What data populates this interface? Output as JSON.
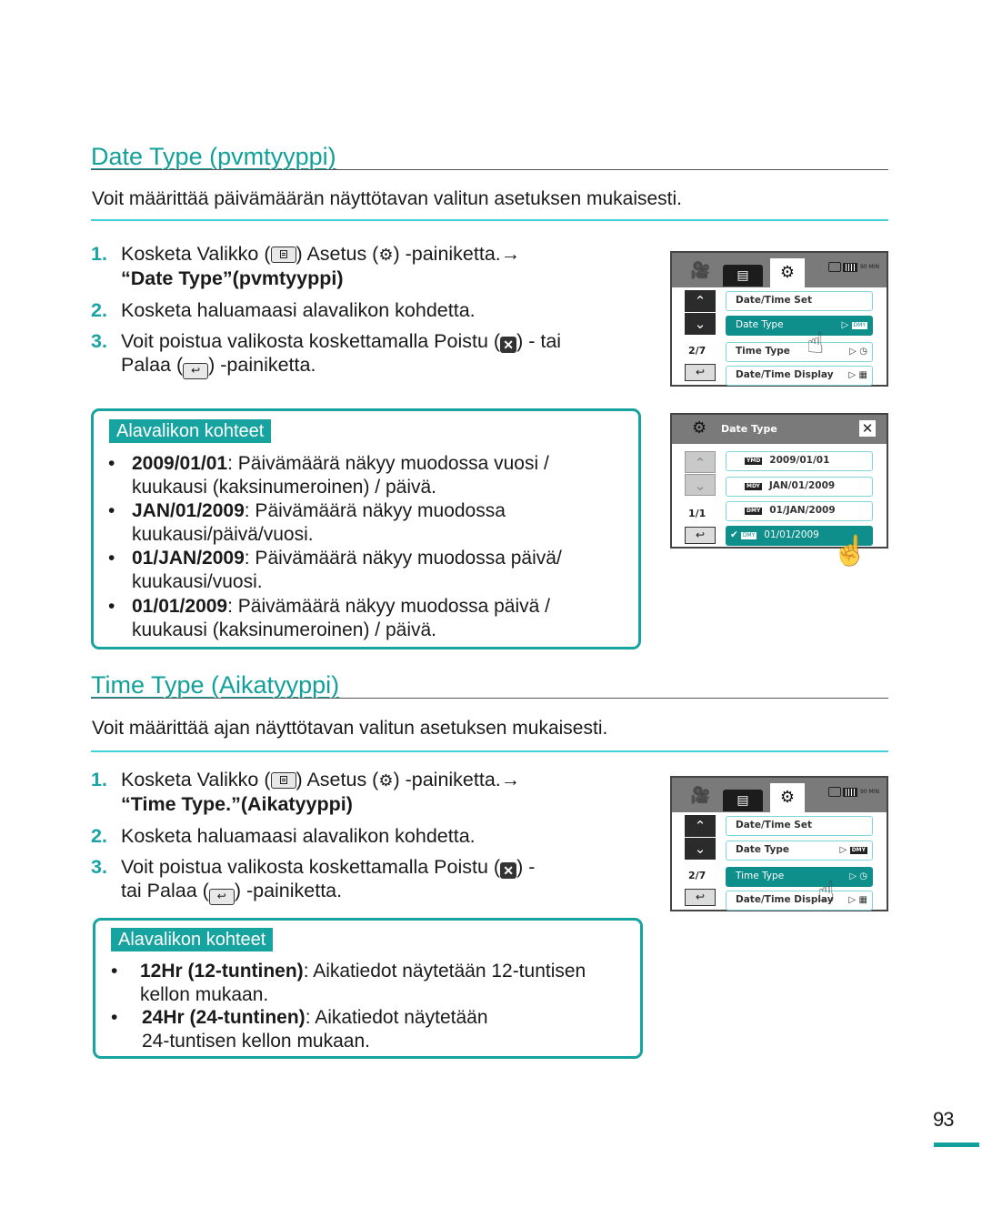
{
  "date_section": {
    "title": "Date Type (pvmtyyppi)",
    "intro": "Voit määrittää päivämäärän näyttötavan valitun asetuksen mukaisesti.",
    "steps": [
      {
        "num": "1.",
        "pre": "Kosketa Valikko (",
        "mid": ") Asetus (",
        "post": ") -painiketta.→",
        "bold": "“Date Type”(pvmtyyppi)"
      },
      {
        "num": "2.",
        "text": "Kosketa haluamaasi alavalikon kohdetta."
      },
      {
        "num": "3.",
        "pre": "Voit poistua valikosta koskettamalla Poistu (",
        "mid": ") - tai",
        "line2_pre": "Palaa (",
        "line2_post": ") -painiketta."
      }
    ],
    "submenu_label": "Alavalikon kohteet",
    "bullets": [
      {
        "bold": "2009/01/01",
        "line1": ": Päivämäärä näkyy muodossa vuosi /",
        "line2": "kuukausi (kaksinumeroinen) / päivä."
      },
      {
        "bold": "JAN/01/2009",
        "line1": ": Päivämäärä näkyy muodossa",
        "line2": "kuukausi/päivä/vuosi."
      },
      {
        "bold": "01/JAN/2009",
        "line1": ": Päivämäärä näkyy muodossa päivä/",
        "line2": "kuukausi/vuosi."
      },
      {
        "bold": "01/01/2009",
        "line1": ": Päivämäärä näkyy muodossa päivä /",
        "line2": "kuukausi (kaksinumeroinen) / päivä."
      }
    ]
  },
  "time_section": {
    "title": "Time Type (Aikatyyppi)",
    "intro": "Voit määrittää ajan näyttötavan valitun asetuksen mukaisesti.",
    "steps": [
      {
        "num": "1.",
        "pre": "Kosketa Valikko (",
        "mid": ") Asetus (",
        "post": ") -painiketta.→",
        "bold": "“Time Type.”(Aikatyyppi)"
      },
      {
        "num": "2.",
        "text": "Kosketa haluamaasi alavalikon kohdetta."
      },
      {
        "num": "3.",
        "pre": "Voit poistua valikosta koskettamalla Poistu (",
        "mid": ") -",
        "line2_pre": "tai Palaa (",
        "line2_post": ") -painiketta."
      }
    ],
    "submenu_label": "Alavalikon kohteet",
    "bullets": [
      {
        "bold": "12Hr (12-tuntinen)",
        "line1": ": Aikatiedot näytetään 12-tuntisen",
        "line2": "kellon mukaan."
      },
      {
        "bold": "24Hr (24-tuntinen)",
        "line1": ": Aikatiedot näytetään",
        "line2": "24-tuntisen kellon mukaan."
      }
    ]
  },
  "screen_menu": {
    "status_min": "90 MIN",
    "pager": "2/7",
    "items": [
      "Date/Time Set",
      "Date Type",
      "Time Type",
      "Date/Time Display"
    ],
    "date_type_icon": "DMY"
  },
  "screen_date_sub": {
    "title": "Date Type",
    "pager": "1/1",
    "options": [
      {
        "icon": "YMD",
        "label": "2009/01/01"
      },
      {
        "icon": "MDY",
        "label": "JAN/01/2009"
      },
      {
        "icon": "DMY",
        "label": "01/JAN/2009"
      },
      {
        "icon": "DMY",
        "label": "01/01/2009",
        "selected": true
      }
    ]
  },
  "page_number": "93"
}
